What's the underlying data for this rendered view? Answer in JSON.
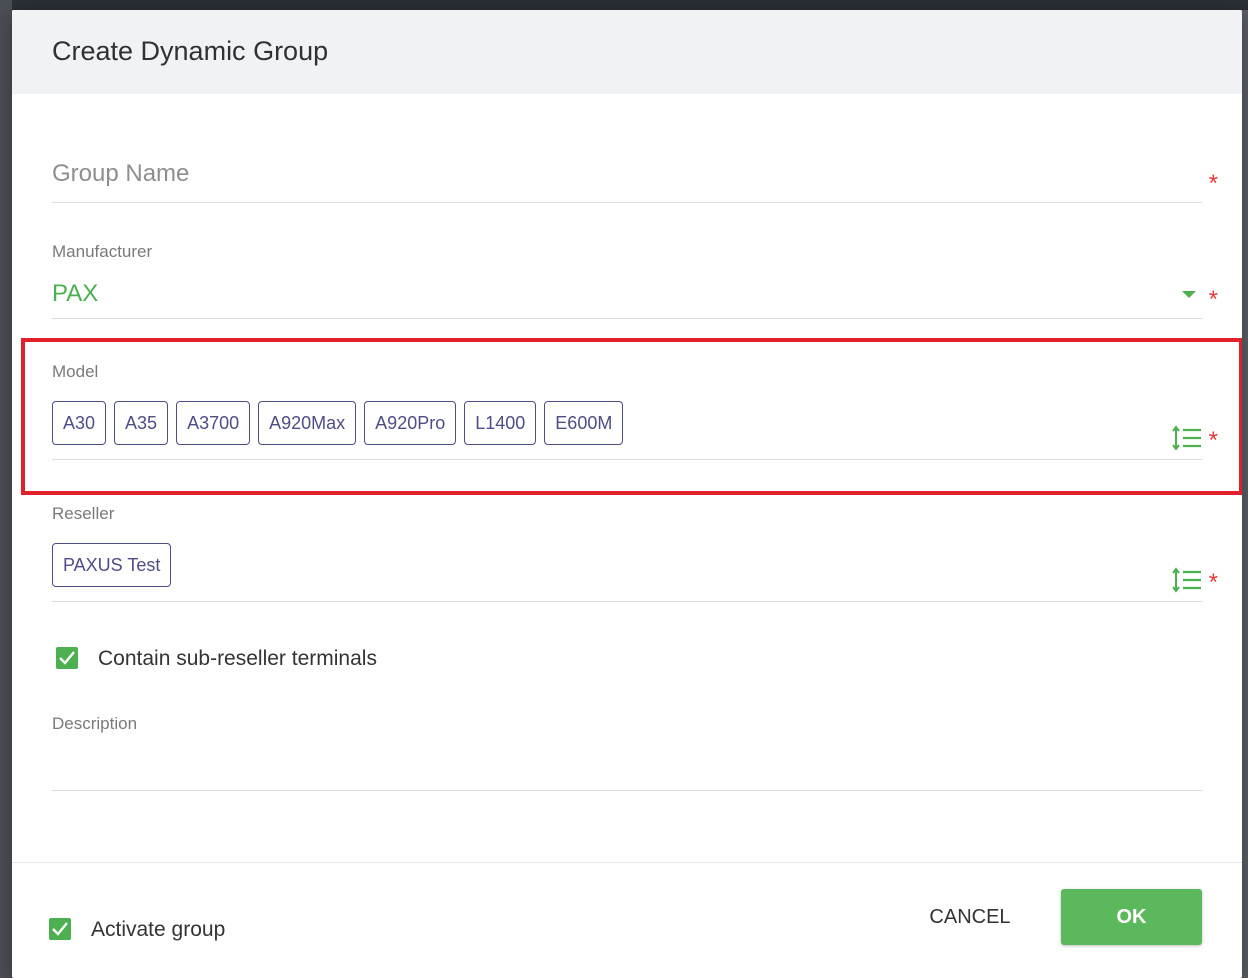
{
  "dialog": {
    "title": "Create Dynamic Group"
  },
  "group_name": {
    "placeholder": "Group Name",
    "required_mark": "*"
  },
  "manufacturer": {
    "label": "Manufacturer",
    "value": "PAX",
    "required_mark": "*"
  },
  "model": {
    "label": "Model",
    "chips": [
      "A30",
      "A35",
      "A3700",
      "A920Max",
      "A920Pro",
      "L1400",
      "E600M"
    ],
    "required_mark": "*"
  },
  "reseller": {
    "label": "Reseller",
    "chips": [
      "PAXUS Test"
    ],
    "required_mark": "*"
  },
  "sub_reseller": {
    "label": "Contain sub-reseller terminals",
    "checked": true
  },
  "description": {
    "label": "Description",
    "value": ""
  },
  "footer": {
    "activate_label": "Activate group",
    "activate_checked": true,
    "cancel_label": "CANCEL",
    "ok_label": "OK"
  },
  "colors": {
    "accent_green": "#4caf50",
    "ok_button": "#5cb85c",
    "chip_border": "#4d4d88",
    "required_red": "#e53935",
    "highlight_red": "#e0202a"
  },
  "icons": {
    "dropdown": "triangle-down-icon",
    "list_picker": "list-sort-icon",
    "checkbox": "checkmark-icon"
  }
}
